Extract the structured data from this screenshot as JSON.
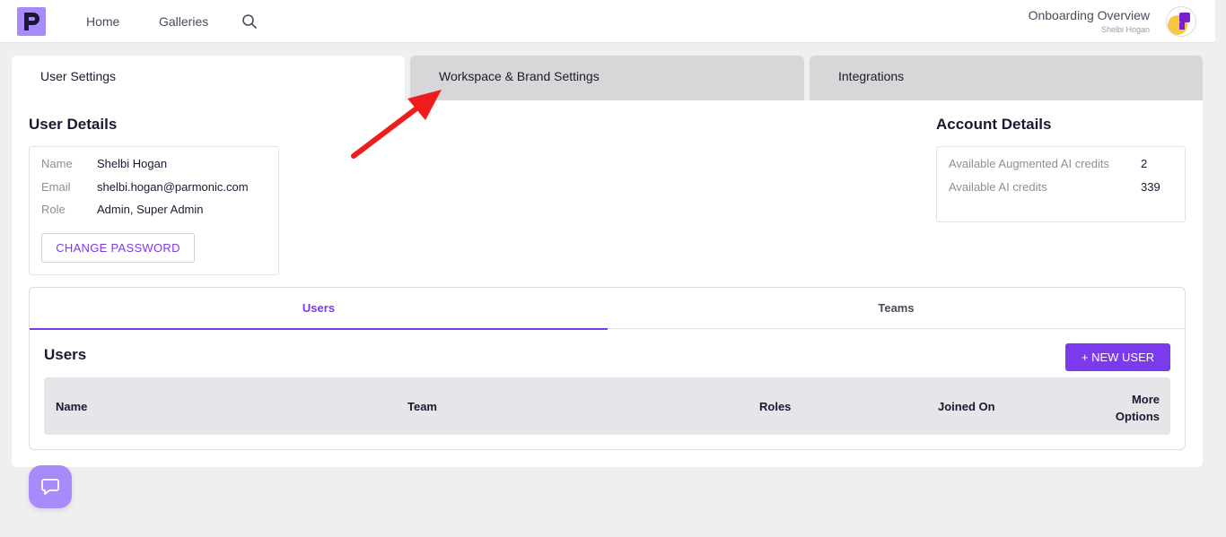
{
  "nav": {
    "logo_letter": "P",
    "home": "Home",
    "galleries": "Galleries",
    "search_icon": "search-icon"
  },
  "profile": {
    "title": "Onboarding Overview",
    "name": "Shelbi Hogan"
  },
  "tabs": [
    {
      "label": "User Settings",
      "active": true
    },
    {
      "label": "Workspace & Brand Settings",
      "active": false
    },
    {
      "label": "Integrations",
      "active": false
    }
  ],
  "user_details": {
    "title": "User Details",
    "fields": [
      {
        "label": "Name",
        "value": "Shelbi Hogan"
      },
      {
        "label": "Email",
        "value": "shelbi.hogan@parmonic.com"
      },
      {
        "label": "Role",
        "value": "Admin, Super Admin"
      }
    ],
    "change_password": "CHANGE PASSWORD"
  },
  "account_details": {
    "title": "Account Details",
    "fields": [
      {
        "label": "Available Augmented AI credits",
        "value": "2"
      },
      {
        "label": "Available AI credits",
        "value": "339"
      }
    ]
  },
  "sub_tabs": [
    {
      "label": "Users",
      "active": true
    },
    {
      "label": "Teams",
      "active": false
    }
  ],
  "users": {
    "heading": "Users",
    "new_user": "+ NEW USER",
    "columns": [
      "Name",
      "Team",
      "Roles",
      "Joined On",
      "More",
      "Options"
    ]
  },
  "colors": {
    "accent": "#7c3aed",
    "logo_bg": "#a78bfa",
    "annotation_arrow": "#ee1c1c"
  }
}
